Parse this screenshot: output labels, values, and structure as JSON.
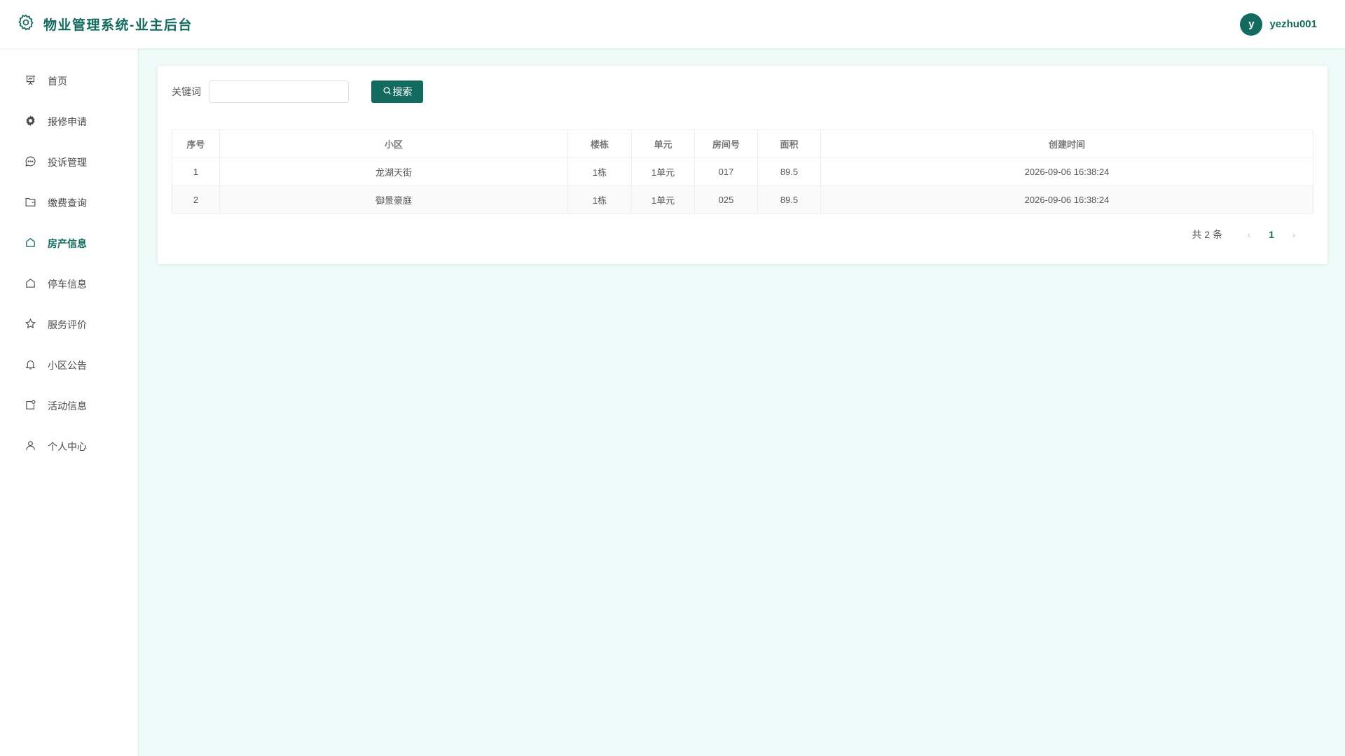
{
  "header": {
    "title": "物业管理系统-业主后台",
    "avatar_letter": "y",
    "username": "yezhu001"
  },
  "colors": {
    "accent": "#136b60",
    "background": "#eefbf8"
  },
  "sidebar": {
    "items": [
      {
        "label": "首页",
        "icon": "presentation-icon"
      },
      {
        "label": "报修申请",
        "icon": "gear-icon"
      },
      {
        "label": "投诉管理",
        "icon": "chat-icon"
      },
      {
        "label": "缴费查询",
        "icon": "folder-icon"
      },
      {
        "label": "房产信息",
        "icon": "home-icon",
        "active": true
      },
      {
        "label": "停车信息",
        "icon": "home-icon"
      },
      {
        "label": "服务评价",
        "icon": "star-icon"
      },
      {
        "label": "小区公告",
        "icon": "bell-icon"
      },
      {
        "label": "活动信息",
        "icon": "calendar-icon"
      },
      {
        "label": "个人中心",
        "icon": "user-icon"
      }
    ]
  },
  "search": {
    "label": "关键词",
    "value": "",
    "placeholder": "",
    "button_label": "搜索"
  },
  "table": {
    "headers": [
      "序号",
      "小区",
      "楼栋",
      "单元",
      "房间号",
      "面积",
      "创建时间"
    ],
    "rows": [
      [
        "1",
        "龙湖天街",
        "1栋",
        "1单元",
        "017",
        "89.5",
        "2026-09-06 16:38:24"
      ],
      [
        "2",
        "御景豪庭",
        "1栋",
        "1单元",
        "025",
        "89.5",
        "2026-09-06 16:38:24"
      ]
    ]
  },
  "pagination": {
    "total_text": "共 2 条",
    "current_page": "1",
    "prev": "‹",
    "next": "›"
  }
}
